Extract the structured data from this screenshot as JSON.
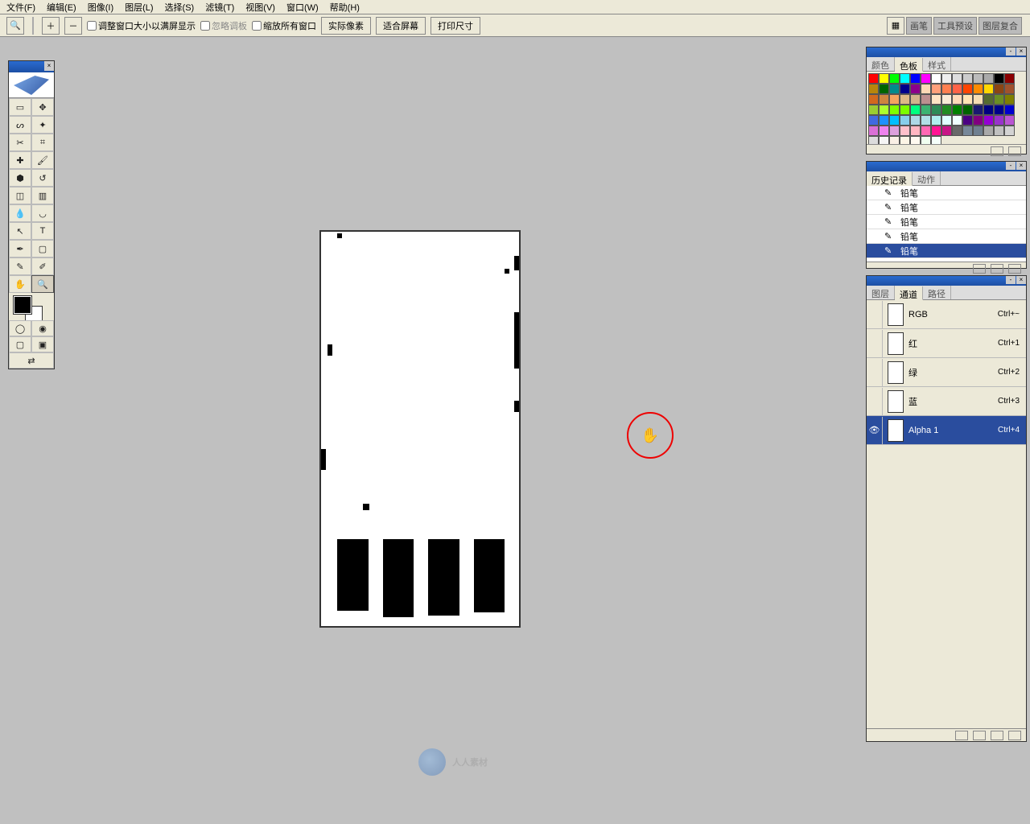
{
  "menu": {
    "file": "文件(F)",
    "edit": "编辑(E)",
    "image": "图像(I)",
    "layer": "图层(L)",
    "select": "选择(S)",
    "filter": "滤镜(T)",
    "view": "视图(V)",
    "window": "窗口(W)",
    "help": "帮助(H)"
  },
  "options": {
    "fit_window": "调整窗口大小以满屏显示",
    "ignore_palettes": "忽略调板",
    "zoom_all": "缩放所有窗口",
    "actual_pixels": "实际像素",
    "fit_screen": "适合屏幕",
    "print_size": "打印尺寸",
    "well_tabs": {
      "brushes": "画笔",
      "tool_presets": "工具预设",
      "layer_comps": "图层复合"
    }
  },
  "swatches_panel": {
    "tab_color": "颜色",
    "tab_swatch": "色板",
    "tab_style": "样式"
  },
  "history_panel": {
    "tab_history": "历史记录",
    "tab_actions": "动作",
    "items": [
      {
        "label": "铅笔"
      },
      {
        "label": "铅笔"
      },
      {
        "label": "铅笔"
      },
      {
        "label": "铅笔"
      },
      {
        "label": "铅笔"
      }
    ]
  },
  "channels_panel": {
    "tab_layers": "图层",
    "tab_channels": "通道",
    "tab_paths": "路径",
    "rows": [
      {
        "name": "RGB",
        "shortcut": "Ctrl+~"
      },
      {
        "name": "红",
        "shortcut": "Ctrl+1"
      },
      {
        "name": "绿",
        "shortcut": "Ctrl+2"
      },
      {
        "name": "蓝",
        "shortcut": "Ctrl+3"
      },
      {
        "name": "Alpha 1",
        "shortcut": "Ctrl+4"
      }
    ]
  },
  "swatch_colors": [
    "#ff0000",
    "#ffff00",
    "#00ff00",
    "#00ffff",
    "#0000ff",
    "#ff00ff",
    "#ffffff",
    "#eeeeee",
    "#dddddd",
    "#cccccc",
    "#bbbbbb",
    "#aaaaaa",
    "#000000",
    "#8b0000",
    "#b8860b",
    "#006400",
    "#008b8b",
    "#00008b",
    "#8b008b",
    "#fdd9b5",
    "#ffa07a",
    "#ff7f50",
    "#ff6347",
    "#ff4500",
    "#ff8c00",
    "#ffd700",
    "#8b4513",
    "#a0522d",
    "#d2691e",
    "#cd853f",
    "#f4a460",
    "#deb887",
    "#d2b48c",
    "#bc8f8f",
    "#ffe4c4",
    "#faebd7",
    "#ffdab9",
    "#ffe4b5",
    "#f5deb3",
    "#556b2f",
    "#6b8e23",
    "#808000",
    "#9acd32",
    "#adff2f",
    "#7fff00",
    "#7cfc00",
    "#00ff7f",
    "#3cb371",
    "#2e8b57",
    "#228b22",
    "#008000",
    "#006400",
    "#191970",
    "#000080",
    "#00008b",
    "#0000cd",
    "#4169e1",
    "#1e90ff",
    "#00bfff",
    "#87ceeb",
    "#add8e6",
    "#b0e0e6",
    "#afeeee",
    "#e0ffff",
    "#f0ffff",
    "#4b0082",
    "#800080",
    "#9400d3",
    "#9932cc",
    "#ba55d3",
    "#da70d6",
    "#ee82ee",
    "#dda0dd",
    "#ffc0cb",
    "#ffb6c1",
    "#ff69b4",
    "#ff1493",
    "#c71585",
    "#696969",
    "#778899",
    "#708090",
    "#a9a9a9",
    "#c0c0c0",
    "#d3d3d3",
    "#dcdcdc",
    "#f5f5f5",
    "#faf0e6",
    "#fdf5e6",
    "#fffaf0",
    "#f0fff0",
    "#f5fffa"
  ],
  "watermark": "人人素材"
}
